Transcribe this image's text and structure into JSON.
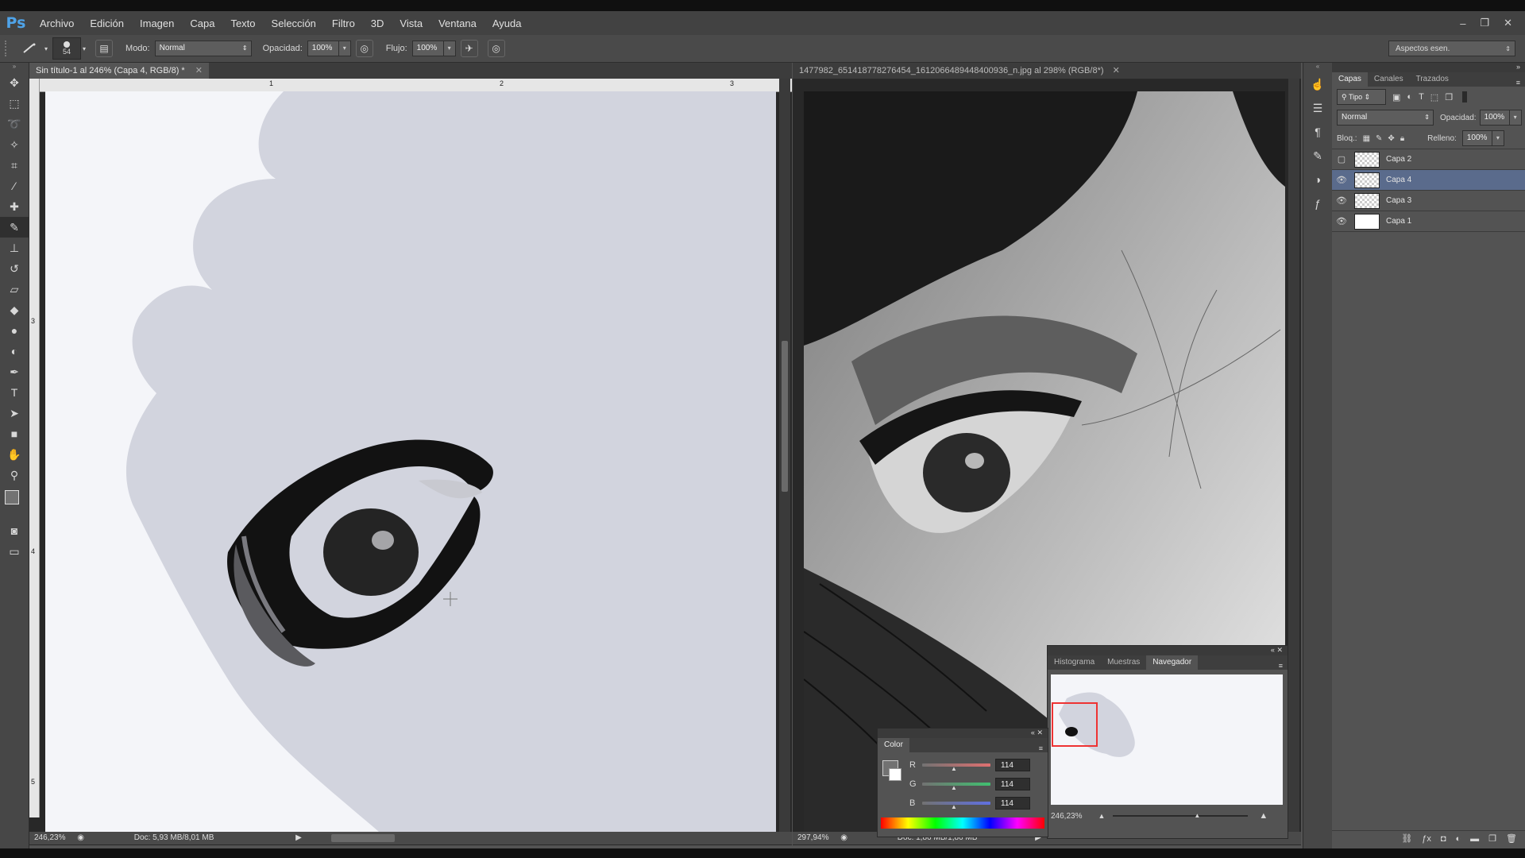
{
  "app": {
    "logo": "Ps"
  },
  "menu": [
    "Archivo",
    "Edición",
    "Imagen",
    "Capa",
    "Texto",
    "Selección",
    "Filtro",
    "3D",
    "Vista",
    "Ventana",
    "Ayuda"
  ],
  "window_controls": {
    "minimize": "–",
    "restore": "❐",
    "close": "✕"
  },
  "options": {
    "brush_size": "54",
    "mode_label": "Modo:",
    "mode_value": "Normal",
    "opacity_label": "Opacidad:",
    "opacity_value": "100%",
    "flow_label": "Flujo:",
    "flow_value": "100%",
    "workspace": "Aspectos esen."
  },
  "tools": [
    "move-tool-icon",
    "marquee-tool-icon",
    "lasso-tool-icon",
    "magic-wand-icon",
    "crop-tool-icon",
    "eyedropper-icon",
    "healing-brush-icon",
    "brush-tool-icon",
    "clone-stamp-icon",
    "history-brush-icon",
    "eraser-icon",
    "paint-bucket-icon",
    "blur-tool-icon",
    "dodge-tool-icon",
    "pen-tool-icon",
    "type-tool-icon",
    "path-select-icon",
    "rectangle-tool-icon",
    "hand-tool-icon",
    "zoom-tool-icon"
  ],
  "doc1": {
    "tab": "Sin título-1 al 246% (Capa 4, RGB/8) *",
    "ruler_marks": [
      "1",
      "2",
      "3"
    ],
    "vruler_marks": [
      "3",
      "4",
      "5"
    ],
    "zoom": "246,23%",
    "doc_info": "Doc: 5,93 MB/8,01 MB"
  },
  "doc2": {
    "tab": "1477982_651418778276454_1612066489448400936_n.jpg al 298% (RGB/8*)",
    "zoom": "297,94%",
    "doc_info": "Doc: 1,86 MB/1,86 MB"
  },
  "layers_panel": {
    "tabs": [
      "Capas",
      "Canales",
      "Trazados"
    ],
    "filter": "Tipo",
    "blend_mode": "Normal",
    "opacity_label": "Opacidad:",
    "opacity": "100%",
    "lock_label": "Bloq.:",
    "fill_label": "Relleno:",
    "fill": "100%",
    "layers": [
      {
        "name": "Capa 2",
        "visible": false,
        "selected": false
      },
      {
        "name": "Capa 4",
        "visible": true,
        "selected": true
      },
      {
        "name": "Capa 3",
        "visible": true,
        "selected": false
      },
      {
        "name": "Capa 1",
        "visible": true,
        "selected": false
      }
    ]
  },
  "navigator": {
    "tabs": [
      "Histograma",
      "Muestras",
      "Navegador"
    ],
    "zoom": "246,23%"
  },
  "color_panel": {
    "title": "Color",
    "r_label": "R",
    "r": "114",
    "g_label": "G",
    "g": "114",
    "b_label": "B",
    "b": "114"
  },
  "colors": {
    "accent_selected": "#5a6b8c",
    "canvas_fill": "#d2d4de",
    "foreground": "#727272"
  }
}
